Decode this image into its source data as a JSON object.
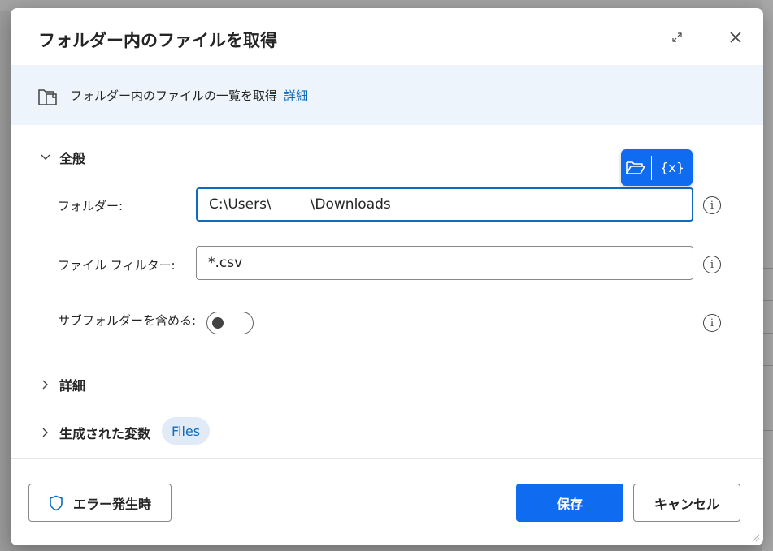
{
  "dialog": {
    "title": "フォルダー内のファイルを取得",
    "info_text": "フォルダー内のファイルの一覧を取得",
    "info_link": "詳細"
  },
  "general_section": {
    "label": "全般"
  },
  "fields": {
    "folder": {
      "label": "フォルダー:",
      "value_prefix": "C:\\Users\\",
      "value_suffix": "\\Downloads"
    },
    "file_filter": {
      "label": "ファイル フィルター:",
      "value": "*.csv"
    },
    "include_subfolders": {
      "label": "サブフォルダーを含める:",
      "checked": false
    }
  },
  "picker": {
    "variable_label": "{x}"
  },
  "details_section": {
    "label": "詳細"
  },
  "generated_vars": {
    "label": "生成された変数",
    "chip": "Files"
  },
  "footer": {
    "on_error_label": "エラー発生時",
    "save_label": "保存",
    "cancel_label": "キャンセル"
  },
  "help_glyph": "i",
  "colors": {
    "accent": "#0f6cf0",
    "link": "#0f6cbd",
    "info_band": "#eef4fb"
  }
}
